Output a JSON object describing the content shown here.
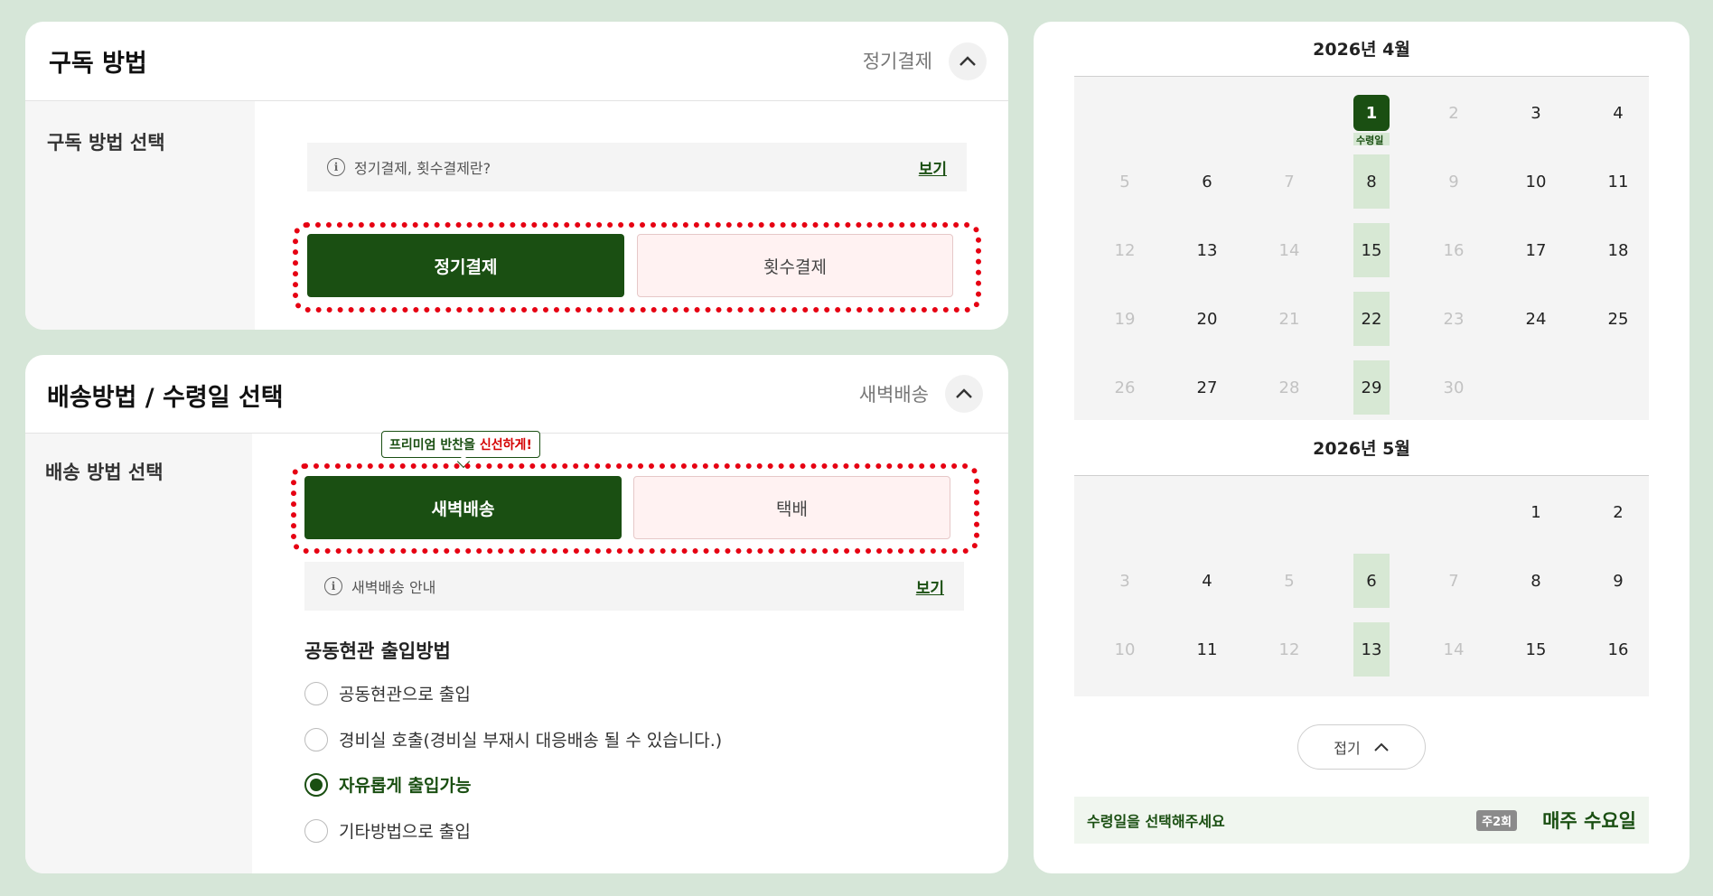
{
  "subscription": {
    "title": "구독 방법",
    "status": "정기결제",
    "side_label": "구독 방법 선택",
    "info_text": "정기결제, 횟수결제란?",
    "info_link": "보기",
    "options": [
      {
        "label": "정기결제",
        "selected": true
      },
      {
        "label": "횟수결제",
        "selected": false
      }
    ]
  },
  "delivery": {
    "title": "배송방법 / 수령일 선택",
    "status": "새벽배송",
    "side_label": "배송 방법 선택",
    "tooltip_prefix": "프리미엄 반찬을 ",
    "tooltip_highlight": "신선하게!",
    "options": [
      {
        "label": "새벽배송",
        "selected": true
      },
      {
        "label": "택배",
        "selected": false
      }
    ],
    "info_text": "새벽배송 안내",
    "info_link": "보기",
    "entry_title": "공동현관 출입방법",
    "entry_options": [
      {
        "label": "공동현관으로 출입",
        "checked": false
      },
      {
        "label": "경비실 호출(경비실 부재시 대응배송 될 수 있습니다.)",
        "checked": false
      },
      {
        "label": "자유롭게 출입가능",
        "checked": true
      },
      {
        "label": "기타방법으로 출입",
        "checked": false
      }
    ]
  },
  "calendar": {
    "april": {
      "title": "2026년 4월",
      "selected_label": "수령일",
      "weeks": [
        [
          "",
          "",
          "",
          "1",
          "2",
          "3",
          "4"
        ],
        [
          "5",
          "6",
          "7",
          "8",
          "9",
          "10",
          "11"
        ],
        [
          "12",
          "13",
          "14",
          "15",
          "16",
          "17",
          "18"
        ],
        [
          "19",
          "20",
          "21",
          "22",
          "23",
          "24",
          "25"
        ],
        [
          "26",
          "27",
          "28",
          "29",
          "30",
          "",
          ""
        ]
      ]
    },
    "may": {
      "title": "2026년 5월",
      "weeks": [
        [
          "",
          "",
          "",
          "",
          "",
          "1",
          "2"
        ],
        [
          "3",
          "4",
          "5",
          "6",
          "7",
          "8",
          "9"
        ],
        [
          "10",
          "11",
          "12",
          "13",
          "14",
          "15",
          "16"
        ]
      ]
    },
    "fold_label": "접기",
    "footer_message": "수령일을 선택해주세요",
    "footer_badge": "주2회",
    "footer_weekly": "매주 수요일"
  },
  "colors": {
    "brand_green": "#1a4f12",
    "wed_highlight": "#d7e8d4",
    "dashed_red": "#e60012",
    "background": "#d6e6d8"
  }
}
